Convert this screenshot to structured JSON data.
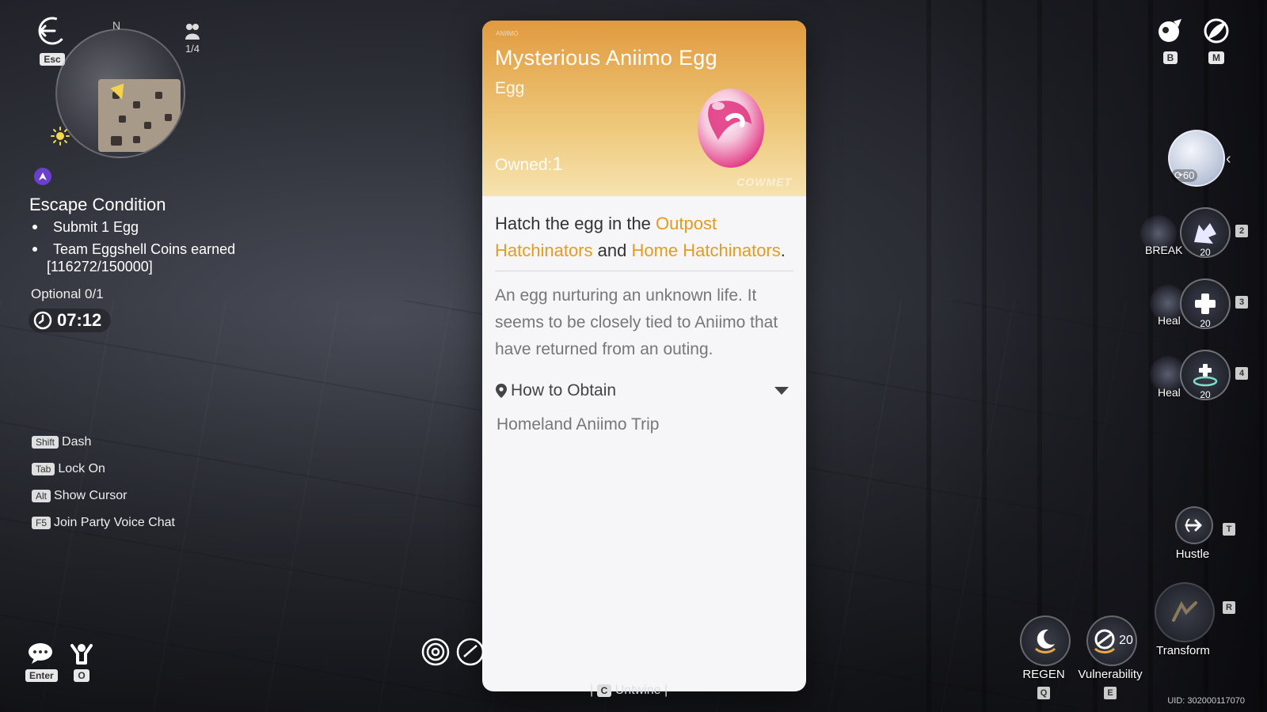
{
  "hud": {
    "esc_key": "Esc",
    "compass_north": "N",
    "party_count": "1/4",
    "objective": {
      "title": "Escape Condition",
      "items": [
        {
          "text": "Submit 1 Egg"
        },
        {
          "text": "Team Eggshell Coins earned",
          "progress": "[116272/150000]"
        }
      ],
      "optional": "Optional 0/1",
      "timer": "07:12"
    },
    "hints": [
      {
        "key": "Shift",
        "label": "Dash"
      },
      {
        "key": "Tab",
        "label": "Lock On"
      },
      {
        "key": "Alt",
        "label": "Show Cursor"
      },
      {
        "key": "F5",
        "label": "Join Party Voice Chat"
      }
    ],
    "chat_key": "Enter",
    "menu_key": "O",
    "bag_key": "B",
    "map_key": "M",
    "pet_level": "60",
    "skills": [
      {
        "label": "BREAK",
        "level": "20",
        "key": "2"
      },
      {
        "label": "Heal",
        "level": "20",
        "key": "3"
      },
      {
        "label": "Heal",
        "level": "20",
        "key": "4"
      }
    ],
    "actions": {
      "hustle": {
        "label": "Hustle",
        "key": "T"
      },
      "transform": {
        "label": "Transform",
        "key": "R"
      },
      "regen": {
        "label": "REGEN",
        "key": "Q"
      },
      "vulnerability": {
        "label": "Vulnerability",
        "key": "E",
        "level": "20"
      }
    },
    "bottom_hint": {
      "key": "C",
      "label": "Untwine"
    },
    "uid": "UID: 302000117070"
  },
  "item_card": {
    "brand_tiny": "ANIIMO",
    "title": "Mysterious Aniimo Egg",
    "type": "Egg",
    "owned_label": "Owned:",
    "owned_count": "1",
    "watermark": "COWMET",
    "hatch": {
      "part1": "Hatch the egg in the ",
      "highlight1": "Outpost Hatchinators",
      "part2": " and ",
      "highlight2": "Home Hatchinators",
      "part3": "."
    },
    "description": "An egg nurturing an unknown life. It seems to be closely tied to Aniimo that have returned from an outing.",
    "obtain_label": "How to Obtain",
    "obtain_source": "Homeland Aniimo Trip"
  },
  "colors": {
    "card_header_top": "#e19a3e",
    "card_header_bottom": "#f6e3b0",
    "highlight": "#e59b1e",
    "egg_pink": "#e0307e"
  }
}
